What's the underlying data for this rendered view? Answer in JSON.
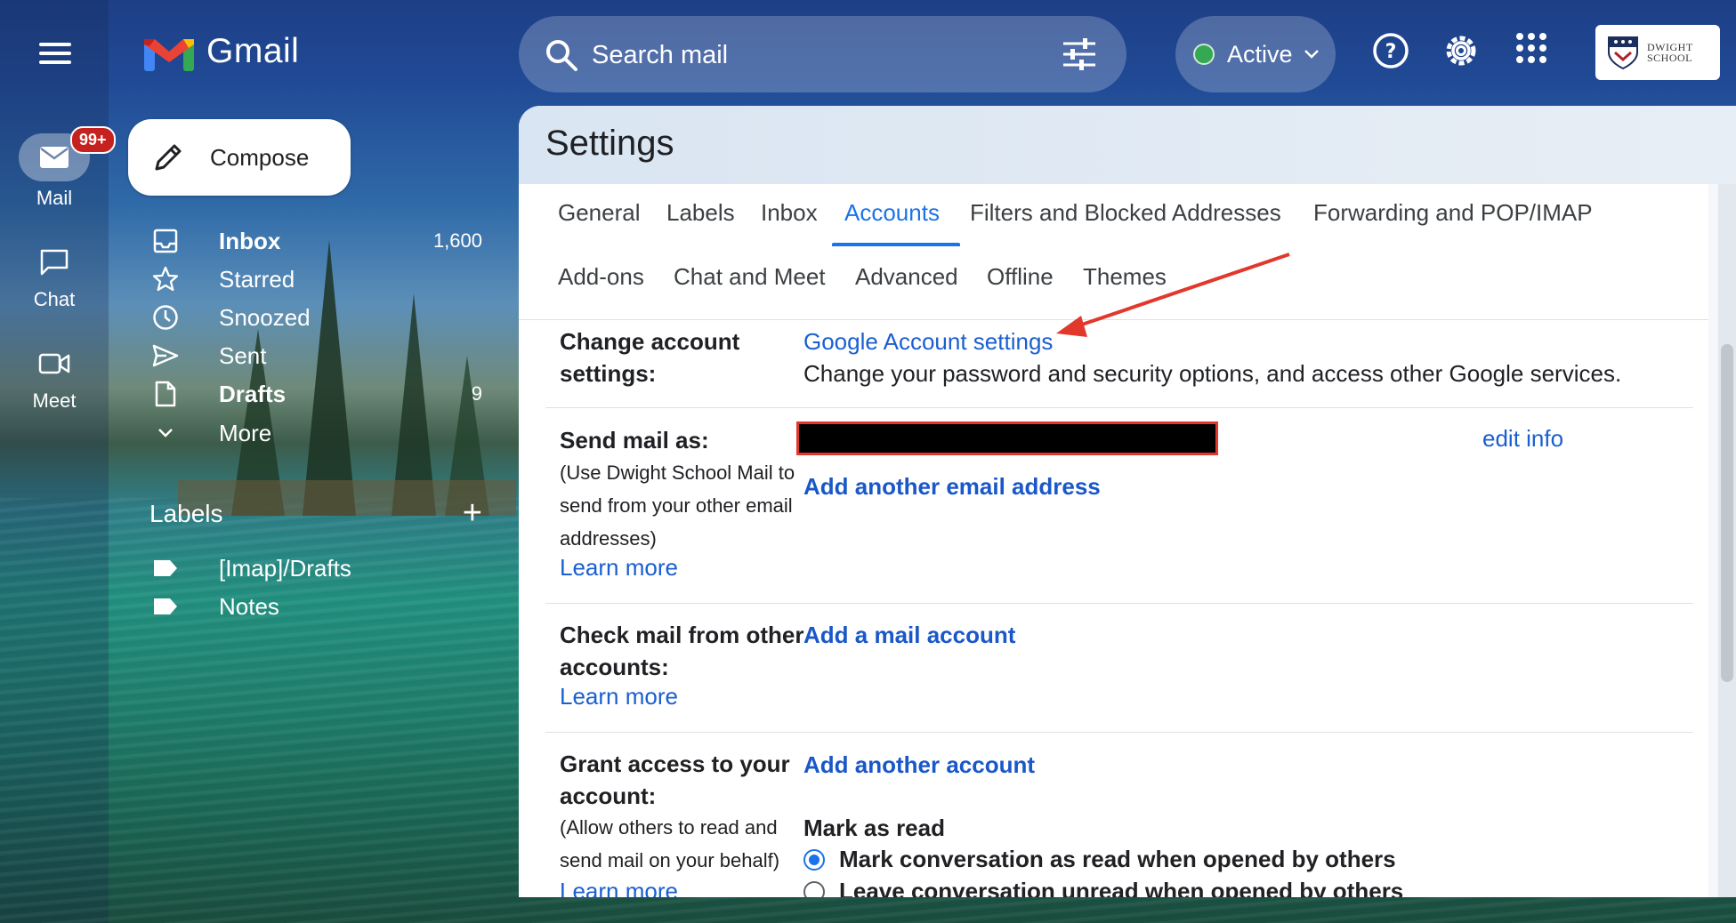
{
  "app": {
    "name": "Gmail",
    "org_logo_text": "DWIGHT SCHOOL"
  },
  "search": {
    "placeholder": "Search mail"
  },
  "status": {
    "label": "Active"
  },
  "rail": {
    "mail": {
      "label": "Mail",
      "badge": "99+"
    },
    "chat": {
      "label": "Chat"
    },
    "meet": {
      "label": "Meet"
    }
  },
  "compose": {
    "label": "Compose"
  },
  "nav": {
    "items": [
      {
        "label": "Inbox",
        "count": "1,600",
        "icon": "inbox-icon"
      },
      {
        "label": "Starred",
        "count": "",
        "icon": "star-icon"
      },
      {
        "label": "Snoozed",
        "count": "",
        "icon": "clock-icon"
      },
      {
        "label": "Sent",
        "count": "",
        "icon": "send-icon"
      },
      {
        "label": "Drafts",
        "count": "9",
        "icon": "draft-icon"
      },
      {
        "label": "More",
        "count": "",
        "icon": "chevron-down-icon"
      }
    ]
  },
  "labels": {
    "heading": "Labels",
    "items": [
      "[Imap]/Drafts",
      "Notes"
    ]
  },
  "settings": {
    "title": "Settings",
    "tabs_row1": [
      "General",
      "Labels",
      "Inbox",
      "Accounts",
      "Filters and Blocked Addresses",
      "Forwarding and POP/IMAP"
    ],
    "tabs_row2": [
      "Add-ons",
      "Chat and Meet",
      "Advanced",
      "Offline",
      "Themes"
    ],
    "active_tab": "Accounts",
    "change_account": {
      "label_line1": "Change account",
      "label_line2": "settings:",
      "link": "Google Account settings",
      "description": "Change your password and security options, and access other Google services."
    },
    "send_mail_as": {
      "label": "Send mail as:",
      "help_lines": [
        "(Use Dwight School Mail to",
        "send from your other email",
        "addresses)"
      ],
      "learn_more": "Learn more",
      "edit_info": "edit info",
      "add_link": "Add another email address"
    },
    "check_mail": {
      "label_line1": "Check mail from other",
      "label_line2": "accounts:",
      "learn_more": "Learn more",
      "add_link": "Add a mail account"
    },
    "grant_access": {
      "label_line1": "Grant access to your",
      "label_line2": "account:",
      "help_lines": [
        "(Allow others to read and",
        "send mail on your behalf)"
      ],
      "learn_more": "Learn more",
      "add_link": "Add another account",
      "mark_as_read_heading": "Mark as read",
      "options": [
        "Mark conversation as read when opened by others",
        "Leave conversation unread when opened by others"
      ],
      "selected_option": 0
    }
  },
  "colors": {
    "accent": "#1a73e8",
    "annotation": "#e2382c",
    "status_active": "#34a853",
    "badge": "#c5221f"
  }
}
